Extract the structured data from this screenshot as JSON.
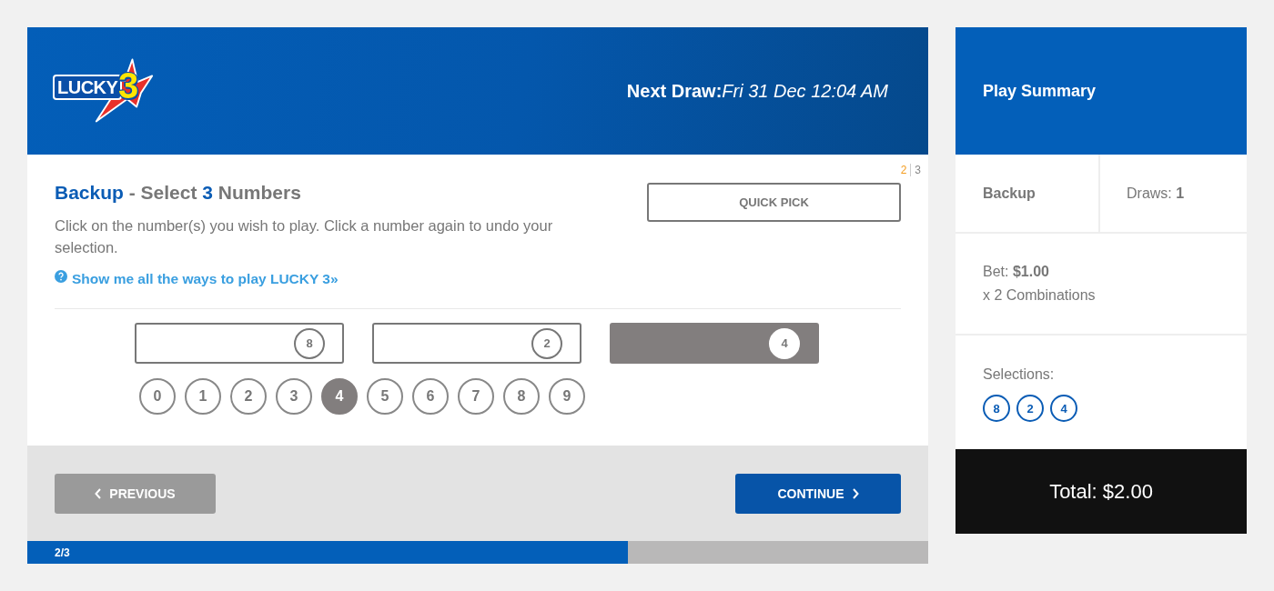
{
  "header": {
    "logo": {
      "word": "LUCKY",
      "number": "3"
    },
    "next_draw": {
      "label": "Next Draw:",
      "value": "Fri 31 Dec 12:04 AM"
    }
  },
  "step_indicator": {
    "current": "2",
    "total": "3"
  },
  "heading": {
    "game": "Backup",
    "prefix": "- Select",
    "count": "3",
    "suffix": "Numbers"
  },
  "instructions": "Click on the number(s) you wish to play. Click a number again to undo your selection.",
  "help_link": "Show me all the ways to play LUCKY 3»",
  "quick_pick": "QUICK PICK",
  "slots": [
    {
      "value": "8",
      "selected": false
    },
    {
      "value": "2",
      "selected": false
    },
    {
      "value": "4",
      "selected": true
    }
  ],
  "numbers": [
    {
      "label": "0",
      "selected": false
    },
    {
      "label": "1",
      "selected": false
    },
    {
      "label": "2",
      "selected": false
    },
    {
      "label": "3",
      "selected": false
    },
    {
      "label": "4",
      "selected": true
    },
    {
      "label": "5",
      "selected": false
    },
    {
      "label": "6",
      "selected": false
    },
    {
      "label": "7",
      "selected": false
    },
    {
      "label": "8",
      "selected": false
    },
    {
      "label": "9",
      "selected": false
    }
  ],
  "nav_buttons": [
    {
      "label": "PREVIOUS",
      "kind": "back",
      "disabled": true
    },
    {
      "label": "CONTINUE",
      "kind": "next",
      "disabled": false
    }
  ],
  "progress": {
    "label": "2/3",
    "level": 0.667
  },
  "summary": {
    "title": "Play Summary",
    "game": "Backup",
    "draws": "Draws: **1**",
    "bet": "Bet: **$1.00**",
    "combinations": "x 2 Combinations",
    "selections_label": "Selections:",
    "selections": [
      "8",
      "2",
      "4"
    ],
    "total": "Total: $2.00"
  }
}
